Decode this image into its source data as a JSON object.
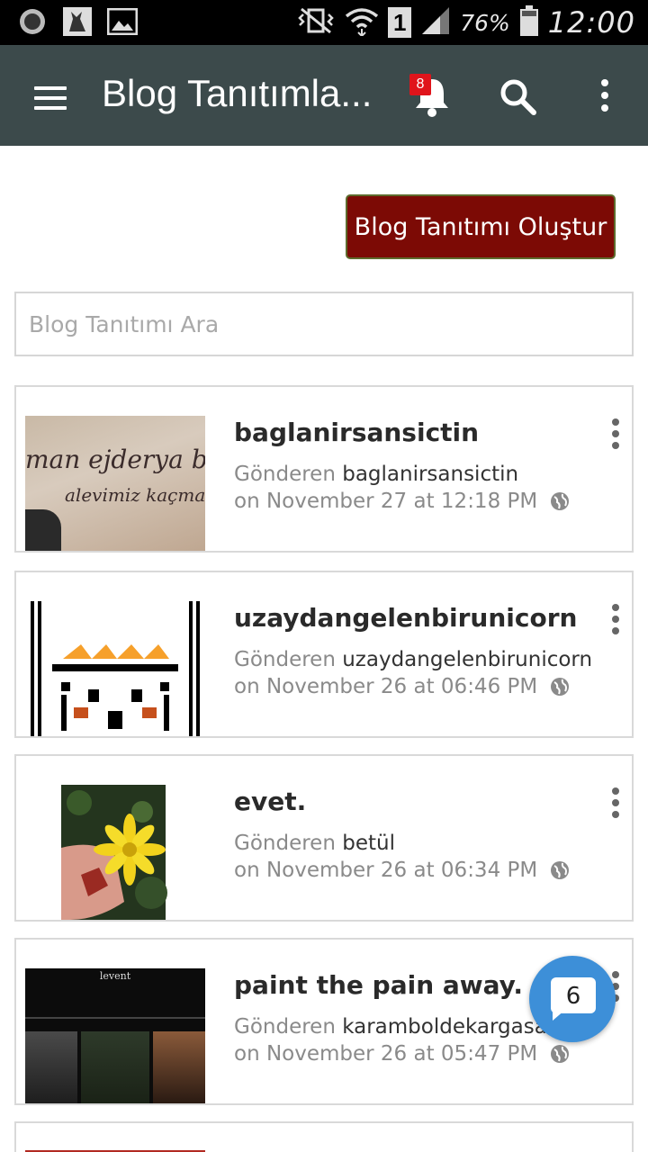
{
  "status_bar": {
    "battery_percent": "76%",
    "sim_slot": "1",
    "clock": "12:00",
    "icons": [
      "circle-icon",
      "goat-app-icon",
      "gallery-icon",
      "vibrate-icon",
      "wifi-icon",
      "sim-icon",
      "signal-icon",
      "battery-icon"
    ]
  },
  "app_bar": {
    "title": "Blog Tanıtımla...",
    "notification_count": "8",
    "color": "#3c4a4b"
  },
  "create_button": {
    "label": "Blog Tanıtımı Oluştur",
    "color": "#7c0a05"
  },
  "search": {
    "placeholder": "Blog Tanıtımı Ara"
  },
  "posts": [
    {
      "title": "baglanirsansictin",
      "sent_by_label": "Gönderen",
      "author": "baglanirsansictin",
      "date": "on November 27 at 12:18 PM",
      "thumb_text": [
        "man ejderya be",
        "alevimiz kaçması"
      ]
    },
    {
      "title": "uzaydangelenbirunicorn",
      "sent_by_label": "Gönderen",
      "author": "uzaydangelenbirunicorn",
      "date": "on November 26 at 06:46 PM"
    },
    {
      "title": "evet.",
      "sent_by_label": "Gönderen",
      "author": "betül",
      "date": "on November 26 at 06:34 PM"
    },
    {
      "title": "paint the pain away.",
      "sent_by_label": "Gönderen",
      "author": "karamboldekargasa",
      "date": "on November 26 at 05:47 PM",
      "thumb_text": [
        "levent"
      ]
    }
  ],
  "chat": {
    "count": "6",
    "color": "#3d8fd8"
  }
}
